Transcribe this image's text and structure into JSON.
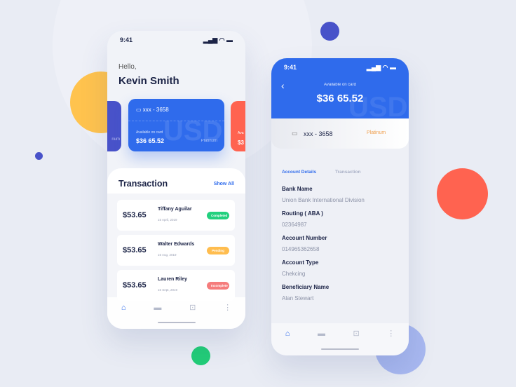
{
  "colors": {
    "blue": "#2f6bec",
    "orange": "#ff6350",
    "yellow": "#ffc34e",
    "green": "#22cc77",
    "indigo": "#4852c9"
  },
  "left": {
    "time": "9:41",
    "greeting": "Hello,",
    "name": "Kevin Smith",
    "card": {
      "number": "xxx - 3658",
      "avail_label": "Available on card",
      "balance": "$36 65.52",
      "tier": "Platinum",
      "watermark": "USD"
    },
    "side_left": {
      "tier": "num"
    },
    "side_right": {
      "label": "Ava",
      "amount": "$3"
    },
    "transaction_title": "Transaction",
    "show_all": "Show All",
    "transactions": [
      {
        "amount": "$53.65",
        "name": "Tiffany Aguilar",
        "date": "15 April, 2019",
        "status": "Completed",
        "color": "#22d07e"
      },
      {
        "amount": "$53.65",
        "name": "Walter Edwards",
        "date": "16 Aug, 2019",
        "status": "Pending",
        "color": "#ffbd4f"
      },
      {
        "amount": "$53.65",
        "name": "Lauren Riley",
        "date": "16 Sept, 2019",
        "status": "Incomplete",
        "color": "#f57c7c"
      }
    ],
    "nav": [
      "home-icon",
      "card-icon",
      "transfer-icon",
      "more-icon"
    ]
  },
  "right": {
    "time": "9:41",
    "avail_label": "Available on card",
    "balance": "$36 65.52",
    "watermark": "USD",
    "card_number": "xxx - 3658",
    "tier": "Platinum",
    "tabs": [
      "Account Details",
      "Transaction"
    ],
    "fields": [
      {
        "label": "Bank Name",
        "value": "Union Bank International Division"
      },
      {
        "label": "Routing ( ABA )",
        "value": "02364987"
      },
      {
        "label": "Account Number",
        "value": "014965362658"
      },
      {
        "label": "Account Type",
        "value": "Chekcing"
      },
      {
        "label": "Beneficiary Name",
        "value": "Alan Stewart"
      }
    ]
  }
}
